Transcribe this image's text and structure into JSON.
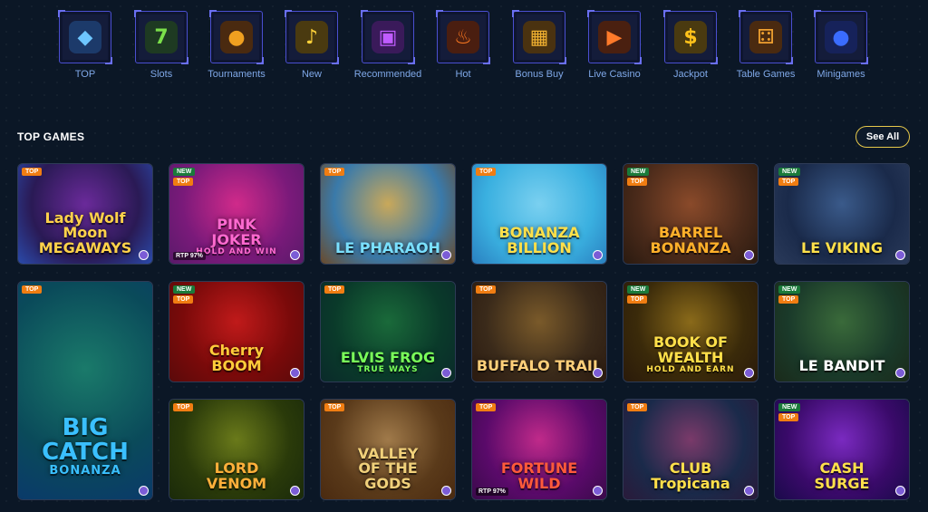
{
  "categories": [
    {
      "label": "TOP",
      "icon": "diamond-icon",
      "glyph": "◆",
      "color": "#6ec6ff",
      "bg": "#1c3a6a"
    },
    {
      "label": "Slots",
      "icon": "seven-icon",
      "glyph": "7",
      "color": "#7be04a",
      "bg": "#1e3a22"
    },
    {
      "label": "Tournaments",
      "icon": "medal-icon",
      "glyph": "●",
      "color": "#f0a020",
      "bg": "#4a2a10"
    },
    {
      "label": "New",
      "icon": "bell-icon",
      "glyph": "♪",
      "color": "#ffd23a",
      "bg": "#4a3a10"
    },
    {
      "label": "Recommended",
      "icon": "slot-machine-icon",
      "glyph": "▣",
      "color": "#c05cff",
      "bg": "#3a1a5a"
    },
    {
      "label": "Hot",
      "icon": "flame-icon",
      "glyph": "♨",
      "color": "#ff7a20",
      "bg": "#4a1e10"
    },
    {
      "label": "Bonus Buy",
      "icon": "treasure-chest-icon",
      "glyph": "▦",
      "color": "#f0b030",
      "bg": "#4a3210"
    },
    {
      "label": "Live Casino",
      "icon": "play-icon",
      "glyph": "▶",
      "color": "#ff7a2a",
      "bg": "#4a2010"
    },
    {
      "label": "Jackpot",
      "icon": "dollar-icon",
      "glyph": "$",
      "color": "#ffc21a",
      "bg": "#4a3a10"
    },
    {
      "label": "Table Games",
      "icon": "dice-icon",
      "glyph": "⚃",
      "color": "#f0a030",
      "bg": "#4a2a10"
    },
    {
      "label": "Minigames",
      "icon": "bomb-icon",
      "glyph": "●",
      "color": "#3a6cff",
      "bg": "#16225a"
    }
  ],
  "section": {
    "title": "TOP GAMES",
    "see_all": "See All"
  },
  "games": [
    {
      "title": "Lady Wolf Moon\nMEGAWAYS",
      "badges": [
        "TOP"
      ],
      "rtp": "",
      "colors": [
        "#2a1a55",
        "#6a2a9a",
        "#2a4aaa"
      ],
      "text_color": "#ffd24a"
    },
    {
      "title": "PINK\nJOKER",
      "sub": "HOLD AND WIN",
      "badges": [
        "NEW",
        "TOP"
      ],
      "rtp": "RTP 97%",
      "colors": [
        "#7a1a7a",
        "#d02a8a",
        "#5a1a6a"
      ],
      "text_color": "#ff6ad0"
    },
    {
      "title": "LE PHARAOH",
      "badges": [
        "TOP"
      ],
      "rtp": "",
      "colors": [
        "#3a7aaa",
        "#c9a85a",
        "#6a4a2a"
      ],
      "text_color": "#7ae0ff"
    },
    {
      "title": "BONANZA\nBILLION",
      "badges": [
        "TOP"
      ],
      "rtp": "",
      "colors": [
        "#3ab0e0",
        "#7ad0f0",
        "#2a80c0"
      ],
      "text_color": "#ffe04a"
    },
    {
      "title": "BARREL\nBONANZA",
      "badges": [
        "NEW",
        "TOP"
      ],
      "rtp": "",
      "colors": [
        "#4a2a1a",
        "#8a4a2a",
        "#2a1a10"
      ],
      "text_color": "#ffb02a"
    },
    {
      "title": "LE VIKING",
      "badges": [
        "NEW",
        "TOP"
      ],
      "rtp": "",
      "colors": [
        "#1a2a4a",
        "#3a5a8a",
        "#2a3a5a"
      ],
      "text_color": "#ffe04a"
    },
    {
      "title": "BIG\nCATCH",
      "sub": "BONANZA",
      "badges": [
        "TOP"
      ],
      "rtp": "",
      "colors": [
        "#0a4a5a",
        "#1a7a6a",
        "#0a3a6a"
      ],
      "text_color": "#3ac0ff"
    },
    {
      "title": "Cherry\nBOOM",
      "badges": [
        "NEW",
        "TOP"
      ],
      "rtp": "",
      "colors": [
        "#7a0a0a",
        "#c01a1a",
        "#5a0a0a"
      ],
      "text_color": "#ffcc3a"
    },
    {
      "title": "ELVIS FROG",
      "sub": "TRUE WAYS",
      "badges": [
        "TOP"
      ],
      "rtp": "",
      "colors": [
        "#0a3a2a",
        "#1a6a3a",
        "#0a2a2a"
      ],
      "text_color": "#7aff5a"
    },
    {
      "title": "BUFFALO TRAIL",
      "badges": [
        "TOP"
      ],
      "rtp": "",
      "colors": [
        "#3a2a1a",
        "#7a5a2a",
        "#2a1a10"
      ],
      "text_color": "#ffd07a"
    },
    {
      "title": "BOOK OF\nWEALTH",
      "sub": "HOLD AND EARN",
      "badges": [
        "NEW",
        "TOP"
      ],
      "rtp": "",
      "colors": [
        "#3a2a0a",
        "#8a6a1a",
        "#2a1a0a"
      ],
      "text_color": "#ffe04a"
    },
    {
      "title": "LE BANDIT",
      "badges": [
        "NEW",
        "TOP"
      ],
      "rtp": "",
      "colors": [
        "#1a3a2a",
        "#3a6a3a",
        "#1a2a1a"
      ],
      "text_color": "#ffffff"
    },
    {
      "title": "LORD\nVENOM",
      "badges": [
        "TOP"
      ],
      "rtp": "",
      "colors": [
        "#2a3a0a",
        "#6a7a1a",
        "#1a2a0a"
      ],
      "text_color": "#ffb03a"
    },
    {
      "title": "VALLEY\nOF THE\nGODS",
      "badges": [
        "TOP"
      ],
      "rtp": "",
      "colors": [
        "#5a3a1a",
        "#a07a4a",
        "#4a2a10"
      ],
      "text_color": "#f0d07a"
    },
    {
      "title": "FORTUNE\nWILD",
      "badges": [
        "TOP"
      ],
      "rtp": "RTP 97%",
      "colors": [
        "#5a0a6a",
        "#c02a8a",
        "#3a0a4a"
      ],
      "text_color": "#ff5a3a"
    },
    {
      "title": "CLUB\nTropicana",
      "badges": [
        "TOP"
      ],
      "rtp": "",
      "colors": [
        "#1a2a4a",
        "#7a3a6a",
        "#2a1a3a"
      ],
      "text_color": "#ffe04a"
    },
    {
      "title": "CASH\nSURGE",
      "badges": [
        "NEW",
        "TOP"
      ],
      "rtp": "",
      "colors": [
        "#3a0a6a",
        "#7a2ac0",
        "#1a0a4a"
      ],
      "text_color": "#ffe04a"
    }
  ]
}
